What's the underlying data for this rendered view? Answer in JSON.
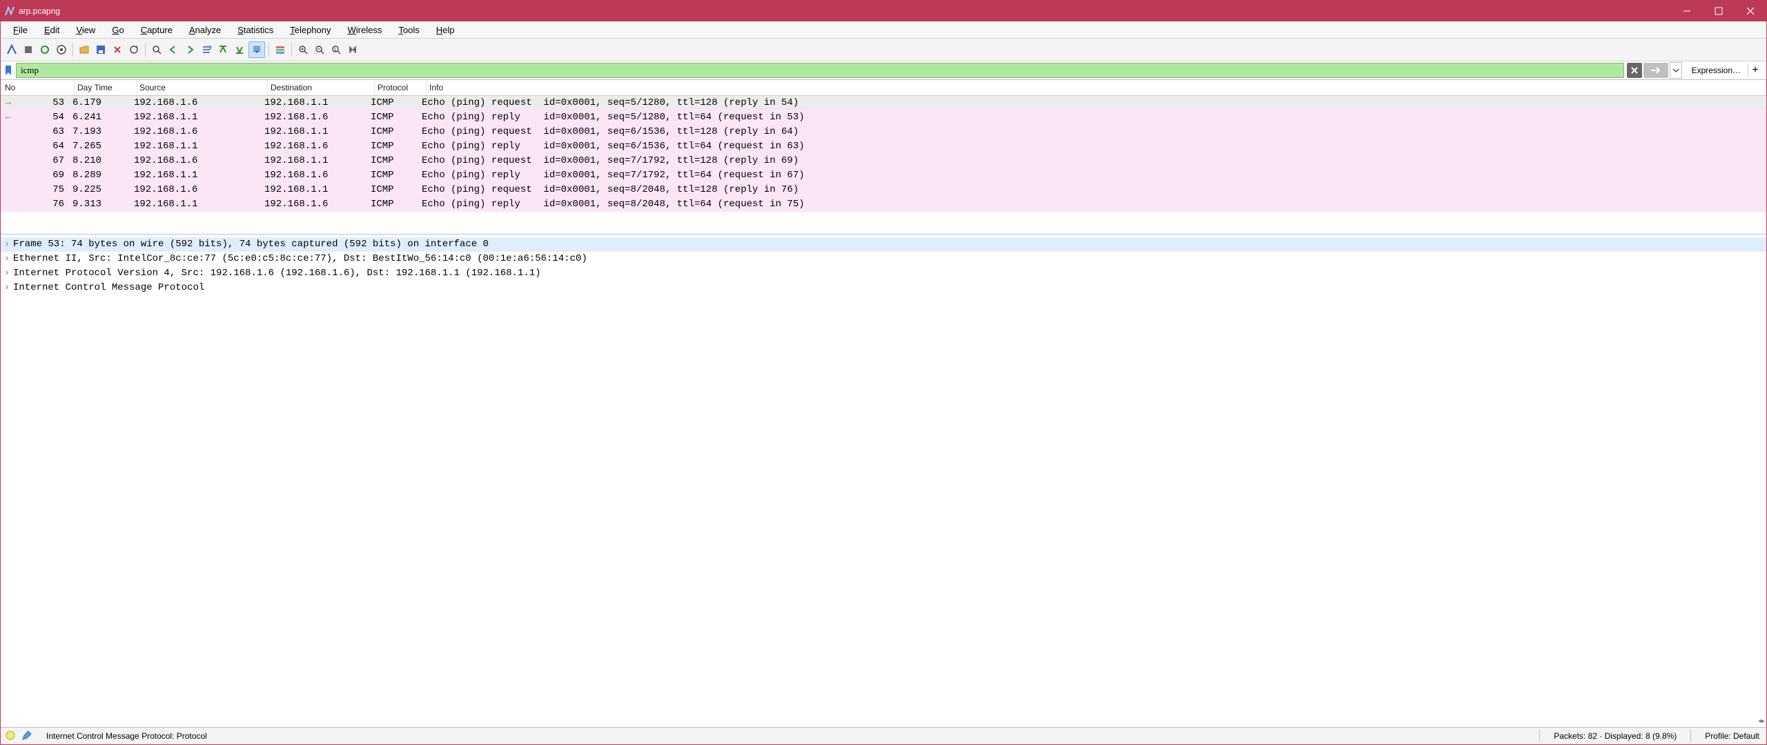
{
  "title": "arp.pcapng",
  "menus": [
    "File",
    "Edit",
    "View",
    "Go",
    "Capture",
    "Analyze",
    "Statistics",
    "Telephony",
    "Wireless",
    "Tools",
    "Help"
  ],
  "filter_value": "icmp",
  "filter_expression_label": "Expression…",
  "columns": {
    "no": "No",
    "time": "Day Time",
    "src": "Source",
    "dst": "Destination",
    "proto": "Protocol",
    "info": "Info"
  },
  "packets": [
    {
      "marker": "→",
      "no": "53",
      "time": "6.179",
      "src": "192.168.1.6",
      "dst": "192.168.1.1",
      "proto": "ICMP",
      "info": "Echo (ping) request  id=0x0001, seq=5/1280, ttl=128 (reply in 54)",
      "sel": true
    },
    {
      "marker": "←",
      "no": "54",
      "time": "6.241",
      "src": "192.168.1.1",
      "dst": "192.168.1.6",
      "proto": "ICMP",
      "info": "Echo (ping) reply    id=0x0001, seq=5/1280, ttl=64 (request in 53)"
    },
    {
      "marker": "",
      "no": "63",
      "time": "7.193",
      "src": "192.168.1.6",
      "dst": "192.168.1.1",
      "proto": "ICMP",
      "info": "Echo (ping) request  id=0x0001, seq=6/1536, ttl=128 (reply in 64)"
    },
    {
      "marker": "",
      "no": "64",
      "time": "7.265",
      "src": "192.168.1.1",
      "dst": "192.168.1.6",
      "proto": "ICMP",
      "info": "Echo (ping) reply    id=0x0001, seq=6/1536, ttl=64 (request in 63)"
    },
    {
      "marker": "",
      "no": "67",
      "time": "8.210",
      "src": "192.168.1.6",
      "dst": "192.168.1.1",
      "proto": "ICMP",
      "info": "Echo (ping) request  id=0x0001, seq=7/1792, ttl=128 (reply in 69)"
    },
    {
      "marker": "",
      "no": "69",
      "time": "8.289",
      "src": "192.168.1.1",
      "dst": "192.168.1.6",
      "proto": "ICMP",
      "info": "Echo (ping) reply    id=0x0001, seq=7/1792, ttl=64 (request in 67)"
    },
    {
      "marker": "",
      "no": "75",
      "time": "9.225",
      "src": "192.168.1.6",
      "dst": "192.168.1.1",
      "proto": "ICMP",
      "info": "Echo (ping) request  id=0x0001, seq=8/2048, ttl=128 (reply in 76)"
    },
    {
      "marker": "",
      "no": "76",
      "time": "9.313",
      "src": "192.168.1.1",
      "dst": "192.168.1.6",
      "proto": "ICMP",
      "info": "Echo (ping) reply    id=0x0001, seq=8/2048, ttl=64 (request in 75)"
    }
  ],
  "details": [
    {
      "text": "Frame 53: 74 bytes on wire (592 bits), 74 bytes captured (592 bits) on interface 0",
      "sel": true
    },
    {
      "text": "Ethernet II, Src: IntelCor_8c:ce:77 (5c:e0:c5:8c:ce:77), Dst: BestItWo_56:14:c0 (00:1e:a6:56:14:c0)"
    },
    {
      "text": "Internet Protocol Version 4, Src: 192.168.1.6 (192.168.1.6), Dst: 192.168.1.1 (192.168.1.1)"
    },
    {
      "text": "Internet Control Message Protocol"
    }
  ],
  "status": {
    "left": "Internet Control Message Protocol: Protocol",
    "packets": "Packets: 82 · Displayed: 8 (9.8%)",
    "profile": "Profile: Default"
  }
}
